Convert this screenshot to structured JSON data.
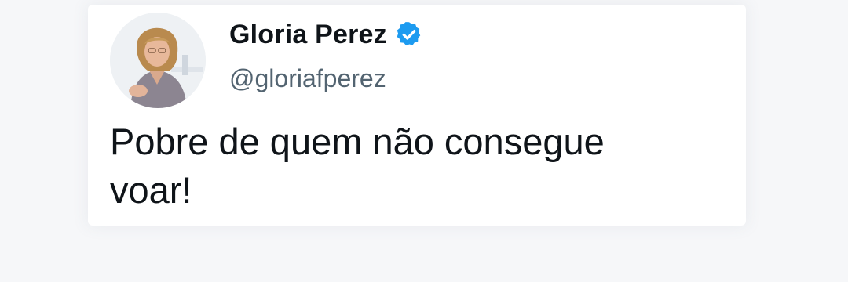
{
  "tweet": {
    "author": {
      "display_name": "Gloria Perez",
      "handle": "@gloriafperez",
      "verified": true,
      "avatar": "profile-photo"
    },
    "text_line1": "Pobre de quem não consegue",
    "text_line2": "voar!"
  },
  "colors": {
    "verified_badge": "#1d9bf0",
    "name_text": "#0f1419",
    "handle_text": "#536471",
    "background": "#f6f7f9"
  }
}
